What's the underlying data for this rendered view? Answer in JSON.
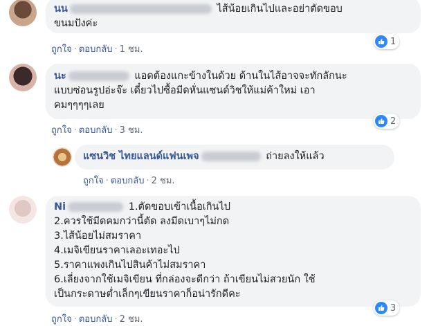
{
  "comments": [
    {
      "author": "นน",
      "text_lines": [
        "ไส้น้อยเกินไปและอย่าตัดขอบ",
        "ขนมปังค่ะ"
      ],
      "like_label": "ถูกใจ",
      "reply_label": "ตอบกลับ",
      "time": "1 ชม.",
      "reaction_count": "1"
    },
    {
      "author": "นะ",
      "text_lines": [
        "แอดต้องแกะข้างในด้วย ด้านในไส้อาจจะทักลักนะ",
        "แบบซ่อนรูปอ่ะจ๊ะ เดี๋ยวไปซื้อมีดหั่นแซนด์วิชให้แม่ค้าใหม่ เอา",
        "คมๆๆๆๆเลย"
      ],
      "like_label": "ถูกใจ",
      "reply_label": "ตอบกลับ",
      "time": "3 ชม.",
      "reaction_count": "2"
    },
    {
      "author": "แซนวิช ไทยแลนด์แฟนเพจ",
      "text": "ถ่ายลงให้แล้ว",
      "like_label": "ถูกใจ",
      "reply_label": "ตอบกลับ",
      "time": "2 ชม."
    },
    {
      "author": "Ni",
      "text_lines": [
        "1.ตัดขอบเข้าเนื้อเกินไป",
        "2.ควรใช้มีดคมกว่านี้ตัด ลงมีดเบาๆไม่กด",
        "3.ไส้น้อยไม่สมราคา",
        "4.เมจิเขียนราคาเลอะเทอะไป",
        "5.ราคาแพงเกินไปสินค้าไม่สมราคา",
        "6.เลี่ยงจากใช้เมจิเขียน ที่กล่องจะดีกว่า ถ้าเขียนไม่สวยนัก ใช้",
        "เป็นกระดาษต่ำเล็กๆเขียนราคาก็อน่ารักดีคะ"
      ],
      "like_label": "ถูกใจ",
      "reply_label": "ตอบกลับ",
      "time": "2 ชม.",
      "reaction_count": "3"
    }
  ],
  "colors": {
    "bubble": "#f2f3f5",
    "name": "#385898",
    "like": "#2d88ff"
  }
}
